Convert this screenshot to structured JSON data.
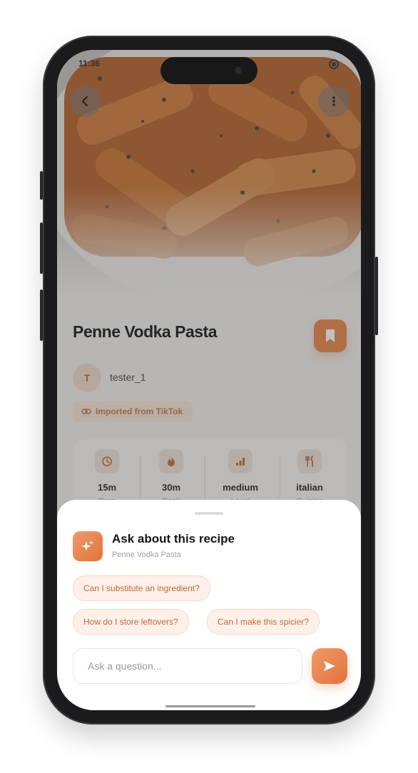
{
  "status_bar": {
    "time": "11:36"
  },
  "recipe": {
    "title": "Penne Vodka Pasta",
    "author_initial": "T",
    "author": "tester_1",
    "source_tag": "Imported from TikTok",
    "stats": [
      {
        "icon": "clock-icon",
        "value": "15m",
        "label": "Prep"
      },
      {
        "icon": "flame-icon",
        "value": "30m",
        "label": "Cook"
      },
      {
        "icon": "bar-chart-icon",
        "value": "medium",
        "label": "Level"
      },
      {
        "icon": "fork-knife-icon",
        "value": "italian",
        "label": "Cuisine"
      }
    ]
  },
  "sheet": {
    "title": "Ask about this recipe",
    "subtitle": "Penne Vodka Pasta",
    "suggestions": [
      "Can I substitute an ingredient?",
      "How do I store leftovers?",
      "Can I make this spicier?"
    ],
    "input_placeholder": "Ask a question..."
  },
  "colors": {
    "accent": "#e8854a",
    "chip_bg": "#fdf0e8",
    "chip_text": "#c06a3c"
  }
}
